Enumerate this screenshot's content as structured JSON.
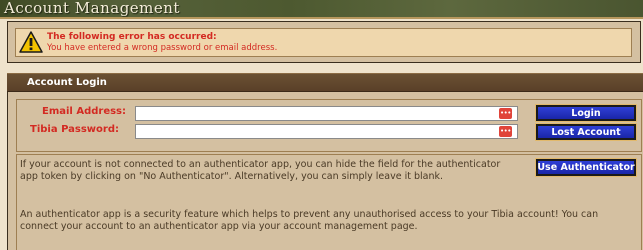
{
  "header": {
    "title": "Account Management"
  },
  "error": {
    "icon": "warning-icon",
    "title": "The following error has occurred:",
    "message": "You have entered a wrong password or email address."
  },
  "login": {
    "section_title": "Account Login",
    "email_label": "Email Address:",
    "email_value": "",
    "password_label": "Tibia Password:",
    "password_value": "",
    "field_icon": "password-manager-icon",
    "login_button": "Login",
    "lost_account_button": "Lost Account",
    "authenticator_button": "Use Authenticator",
    "info_paragraph_1": "If your account is not connected to an authenticator app, you can hide the field for the authenticator app token by clicking on \"No Authenticator\". Alternatively, you can simply leave it blank.",
    "info_paragraph_2": "An authenticator app is a security feature which helps to prevent any unauthorised access to your Tibia account! You can connect your account to an authenticator app via your account management page."
  },
  "colors": {
    "error_text": "#d32a22",
    "button_blue": "#1a26a8",
    "panel_bg": "#d4c0a1",
    "header_bar": "#5a4028"
  }
}
